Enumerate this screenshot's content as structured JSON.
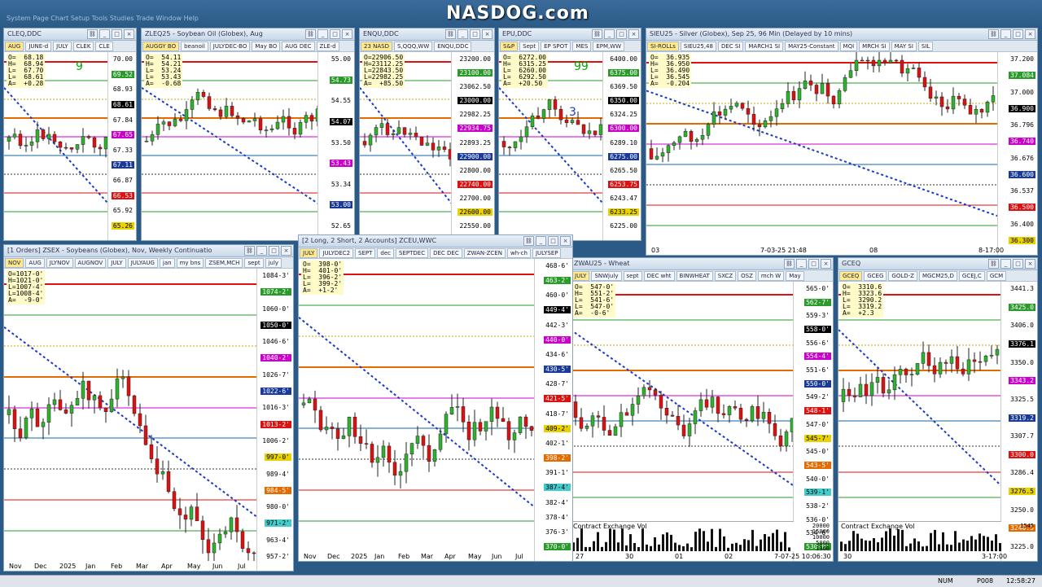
{
  "app": {
    "logo": "NASDOG.com",
    "menu": "System  Page  Chart Setup  Tools  Studies  Trade  Window  Help"
  },
  "windows": {
    "cleq": {
      "title": "CLEQ,DDC",
      "tabs": [
        "AUG",
        "JUNE-d",
        "JULY",
        "CLEK",
        "CLE"
      ],
      "ohlc": "O=  68.18\nH=  68.94\nL=  67.70\nL=  68.61\nA=  +0.28",
      "count": "9",
      "prices": [
        "70.00",
        "69.52",
        "68.93",
        "68.61",
        "67.84",
        "67.65",
        "67.33",
        "67.11",
        "66.87",
        "66.53",
        "65.92",
        "65.26"
      ]
    },
    "zleq": {
      "title": "ZLEQ25 - Soybean Oil (Globex), Aug",
      "tabs": [
        "AUGGY BO",
        "beanoil",
        "JULYDEC-BO",
        "May BO",
        "AUG DEC",
        "ZLE-d"
      ],
      "ohlc": "O=  54.11\nH=  54.21\nL=  53.24\nL=  53.43\nA=  -0.68",
      "prices": [
        "55.00",
        "54.73",
        "54.55",
        "54.07",
        "53.50",
        "53.43",
        "53.34",
        "53.00",
        "52.65"
      ]
    },
    "enqu": {
      "title": "ENQU,DDC",
      "tabs": [
        "23 NASD",
        "S,QQQ,WW",
        "ENQU,DDC"
      ],
      "ohlc": "O=22906.50\nH=23112.25\nL=22843.50\nL=22982.25\nA=  +85.50",
      "prices": [
        "23200.00",
        "23100.00",
        "23062.50",
        "23000.00",
        "22982.25",
        "22934.75",
        "22893.25",
        "22900.00",
        "22800.00",
        "22740.00",
        "22700.00",
        "22600.00",
        "22550.00"
      ]
    },
    "epu": {
      "title": "EPU,DDC",
      "tabs": [
        "S&P",
        "Sept",
        "EP SPOT",
        "MES",
        "EPM,WW"
      ],
      "ohlc": "O=  6272.00\nH=  6315.25\nL=  6260.00\nL=  6292.50\nA=  +20.50",
      "count": "99",
      "marker": "3",
      "prices": [
        "6400.00",
        "6375.00",
        "6369.50",
        "6350.00",
        "6324.25",
        "6300.00",
        "6289.10",
        "6275.00",
        "6265.50",
        "6253.75",
        "6243.47",
        "6233.25",
        "6225.00"
      ]
    },
    "sieu": {
      "title": "SIEU25 - Silver (Globex), Sep 25, 96 Min (Delayed by 10 mins)",
      "tabs": [
        "SI-ROLLs",
        "SIEU25,48",
        "DEC SI",
        "MARCH1 SI",
        "MAY25-Constant",
        "MQI",
        "MRCH SI",
        "MAY SI",
        "SIL"
      ],
      "ohlc": "O=  36.935\nH=  36.950\nL=  36.490\nL=  36.545\nA=  -0.204",
      "prices": [
        "37.200",
        "37.084",
        "37.000",
        "36.900",
        "36.796",
        "36.740",
        "36.676",
        "36.600",
        "36.537",
        "36.500",
        "36.400",
        "36.300"
      ],
      "dates": [
        "03",
        "7-03-25 21:48",
        "08",
        "8-17:00"
      ]
    },
    "zsex": {
      "title": "[1 Orders]  ZSEX - Soybeans (Globex), Nov, Weekly Continuatio",
      "tabs": [
        "NOV",
        "AUG",
        "JLYNOV",
        "AUGNOV",
        "JULY",
        "JULYAUG",
        "jan",
        "my bns",
        "ZSEM,MCH",
        "sept",
        "july"
      ],
      "ohlc": "O=1017-0'\nH=1021-0'\nL=1007-4'\nL=1008-4'\nA=  -9-0'",
      "prices": [
        "1084-3'",
        "1074-2'",
        "1060-0'",
        "1050-0'",
        "1046-6'",
        "1040-2'",
        "1026-7'",
        "1022-6'",
        "1016-3'",
        "1013-2'",
        "1006-2'",
        "997-0'",
        "989-4'",
        "984-5'",
        "980-0'",
        "971-2'",
        "963-4'",
        "957-2'"
      ],
      "dates": [
        "Nov",
        "Dec",
        "2025",
        "Jan",
        "Feb",
        "Mar",
        "Apr",
        "May",
        "Jun",
        "Jul"
      ]
    },
    "zceu": {
      "title": "[2 Long, 2 Short, 2 Accounts]  ZCEU,WWC",
      "tabs": [
        "JULY",
        "JULYDEC2",
        "SEPT",
        "dec",
        "SEPTDEC",
        "DEC DEC",
        "ZWAN-ZCEN",
        "wh-ch",
        "JULYSEP"
      ],
      "ohlc": "O=  398-0'\nH=  401-0'\nL=  396-2'\nL=  399-2'\nA=  +1-2'",
      "prices": [
        "468-6'",
        "463-2'",
        "460-0'",
        "449-4'",
        "442-3'",
        "440-0'",
        "434-6'",
        "430-5'",
        "428-7'",
        "421-5'",
        "418-7'",
        "409-2'",
        "402-1'",
        "398-2'",
        "391-1'",
        "387-4'",
        "382-4'",
        "378-4'",
        "376-3'",
        "370-0'"
      ],
      "dates": [
        "Nov",
        "Dec",
        "2025",
        "Jan",
        "Feb",
        "Mar",
        "Apr",
        "May",
        "Jun",
        "Jul"
      ]
    },
    "zwau": {
      "title": "ZWAU25 - Wheat",
      "tabs": [
        "JULY",
        "SNWjuly",
        "sept",
        "DEC wht",
        "BINWHEAT",
        "SXCZ",
        "OSZ",
        "mch W",
        "May"
      ],
      "ohlc": "O=  547-0'\nH=  551-2'\nL=  541-6'\nL=  547-0'\nA=  -0-6'",
      "prices": [
        "565-0'",
        "562-7'",
        "559-3'",
        "558-0'",
        "556-6'",
        "554-4'",
        "551-6'",
        "550-0'",
        "549-2'",
        "548-1'",
        "547-0'",
        "545-7'",
        "545-0'",
        "543-5'",
        "540-0'",
        "539-1'",
        "538-2'",
        "536-0'",
        "534-6'",
        "530-0'"
      ],
      "vol_label": "Contract Exchange Vol",
      "vol_ticks": [
        "20000",
        "15000",
        "10000",
        "5000",
        "1360"
      ],
      "dates": [
        "27",
        "30",
        "01",
        "02",
        "7-07-25 10:06:30"
      ]
    },
    "gceq": {
      "title": "GCEQ",
      "tabs": [
        "GCEQ",
        "GCEG",
        "GOLD-Z",
        "MGCM25,D",
        "GCEJ,C",
        "GCM"
      ],
      "ohlc": "O=  3310.6\nH=  3323.6\nL=  3290.2\nL=  3319.2\nA=  +2.3",
      "prices": [
        "3441.3",
        "3425.0",
        "3406.0",
        "3376.1",
        "3350.0",
        "3343.2",
        "3325.5",
        "3319.2",
        "3307.7",
        "3300.0",
        "3286.4",
        "3276.5",
        "3250.0",
        "3240.5",
        "3225.0"
      ],
      "vol_label": "Contract Exchange Vol",
      "vol_ticks": [
        "1545"
      ],
      "dates": [
        "30",
        "3-17:00"
      ]
    }
  },
  "status": {
    "num": "NUM",
    "page": "P008",
    "time": "12:58:27"
  },
  "colors": {
    "up": "#2fb32f",
    "down": "#d11",
    "bg": "#2b5a86"
  }
}
